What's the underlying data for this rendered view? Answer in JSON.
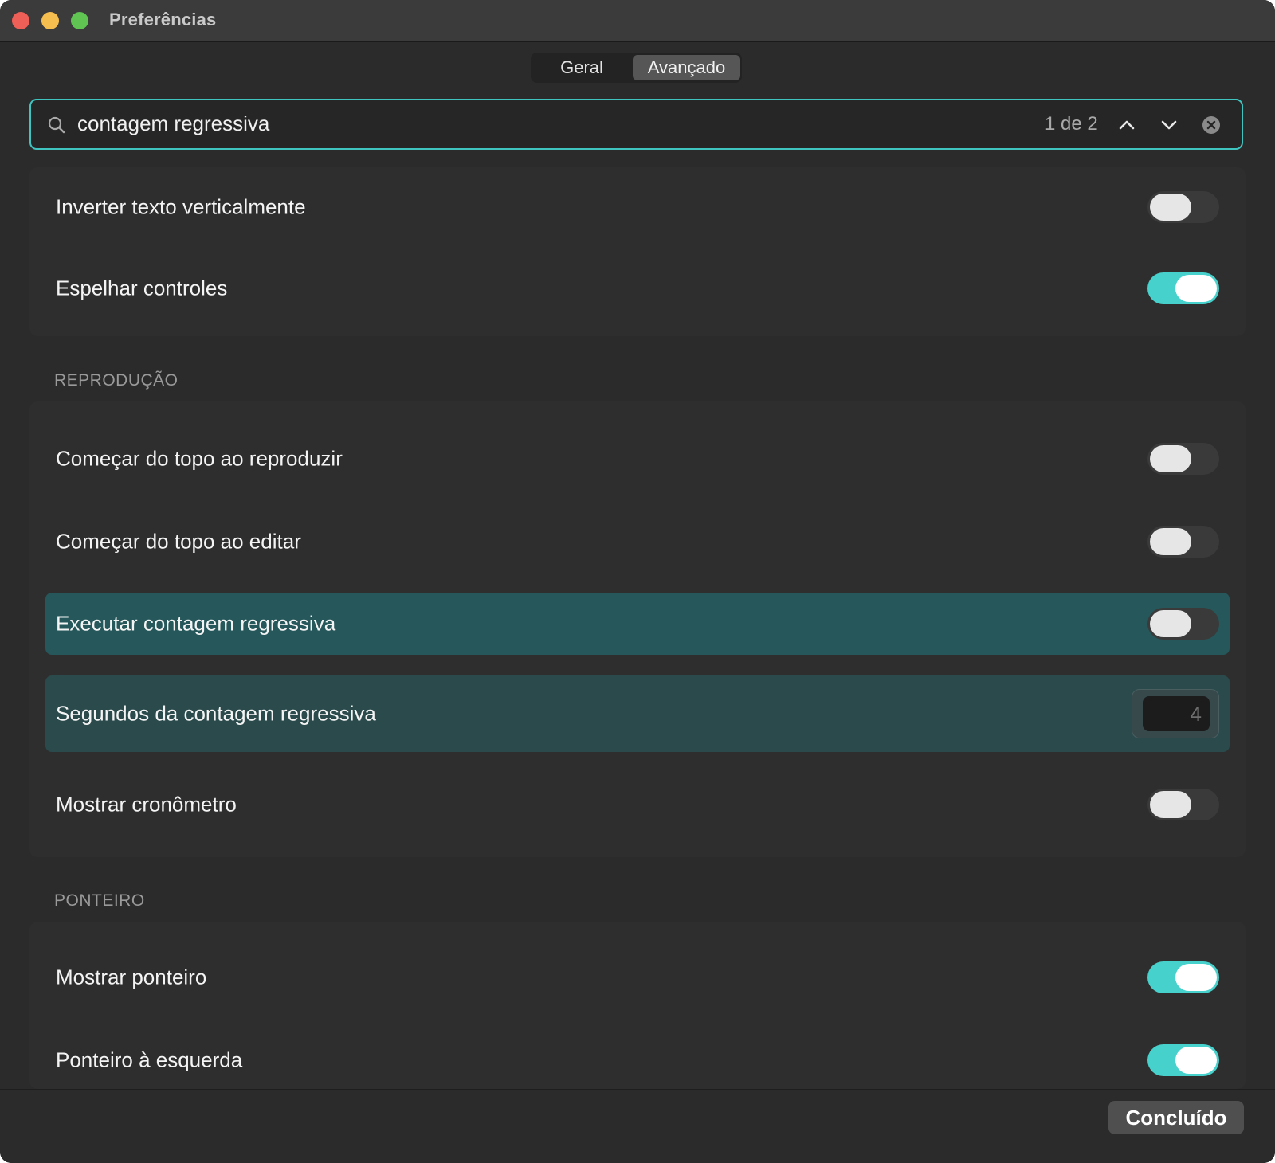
{
  "window": {
    "title": "Preferências"
  },
  "tabs": [
    {
      "label": "Geral",
      "selected": false
    },
    {
      "label": "Avançado",
      "selected": true
    }
  ],
  "search": {
    "value": "contagem regressiva",
    "match_count": "1 de 2"
  },
  "colors": {
    "accent": "#47d1cc",
    "highlight": "#26575a",
    "background": "#2b2b2b"
  },
  "group_top": {
    "items": [
      {
        "label": "Inverter texto verticalmente",
        "toggle": false
      },
      {
        "label": "Espelhar controles",
        "toggle": true
      }
    ]
  },
  "reproducao": {
    "header": "REPRODUÇÃO",
    "items": [
      {
        "label": "Começar do topo ao reproduzir",
        "toggle": false
      },
      {
        "label": "Começar do topo ao editar",
        "toggle": false
      },
      {
        "label": "Executar contagem regressiva",
        "toggle": false,
        "highlighted": true
      },
      {
        "label": "Segundos da contagem regressiva",
        "value": "4",
        "highlighted": true
      },
      {
        "label": "Mostrar cronômetro",
        "toggle": false
      }
    ]
  },
  "ponteiro": {
    "header": "PONTEIRO",
    "items": [
      {
        "label": "Mostrar ponteiro",
        "toggle": true
      },
      {
        "label": "Ponteiro à esquerda",
        "toggle": true
      }
    ]
  },
  "footer": {
    "done_label": "Concluído"
  },
  "icons": [
    "search-icon",
    "chevron-up-icon",
    "chevron-down-icon",
    "clear-icon"
  ]
}
